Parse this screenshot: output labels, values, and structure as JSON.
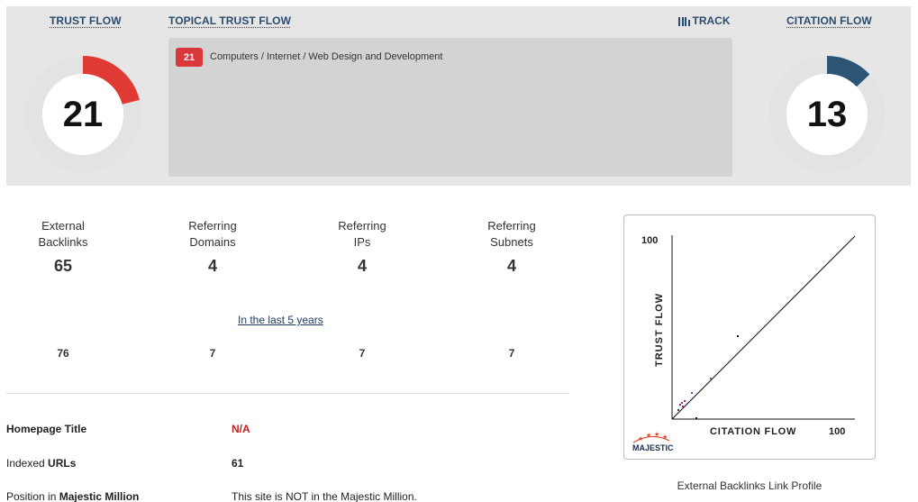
{
  "header": {
    "trust_flow_label": "TRUST FLOW",
    "topical_trust_flow_label": "TOPICAL TRUST FLOW",
    "track_label": "TRACK",
    "citation_flow_label": "CITATION FLOW"
  },
  "trust_flow": {
    "value": "21",
    "fraction": 0.21,
    "color": "#e03a35"
  },
  "citation_flow": {
    "value": "13",
    "fraction": 0.13,
    "color": "#2d5475"
  },
  "topical_trust_flow": {
    "items": [
      {
        "score": "21",
        "topic": "Computers / Internet / Web Design and Development",
        "color": "#d9373a"
      }
    ]
  },
  "stats": [
    {
      "label_line1": "External",
      "label_line2": "Backlinks",
      "value": "65",
      "historic": "76"
    },
    {
      "label_line1": "Referring",
      "label_line2": "Domains",
      "value": "4",
      "historic": "7"
    },
    {
      "label_line1": "Referring",
      "label_line2": "IPs",
      "value": "4",
      "historic": "7"
    },
    {
      "label_line1": "Referring",
      "label_line2": "Subnets",
      "value": "4",
      "historic": "7"
    }
  ],
  "history_link": "In the last 5 years",
  "info": {
    "homepage_title_label": "Homepage Title",
    "homepage_title_value": "N/A",
    "indexed_urls_label_prefix": "Indexed ",
    "indexed_urls_label_bold": "URLs",
    "indexed_urls_value": "61",
    "position_label_prefix": "Position in ",
    "position_label_bold": "Majestic Million",
    "position_value": "This site is NOT in the Majestic Million."
  },
  "link_profile": {
    "caption": "External Backlinks Link Profile",
    "y_label": "TRUST FLOW",
    "x_label": "CITATION FLOW",
    "y_max_label": "100",
    "x_max_label": "100",
    "logo_text": "MAJESTIC"
  }
}
